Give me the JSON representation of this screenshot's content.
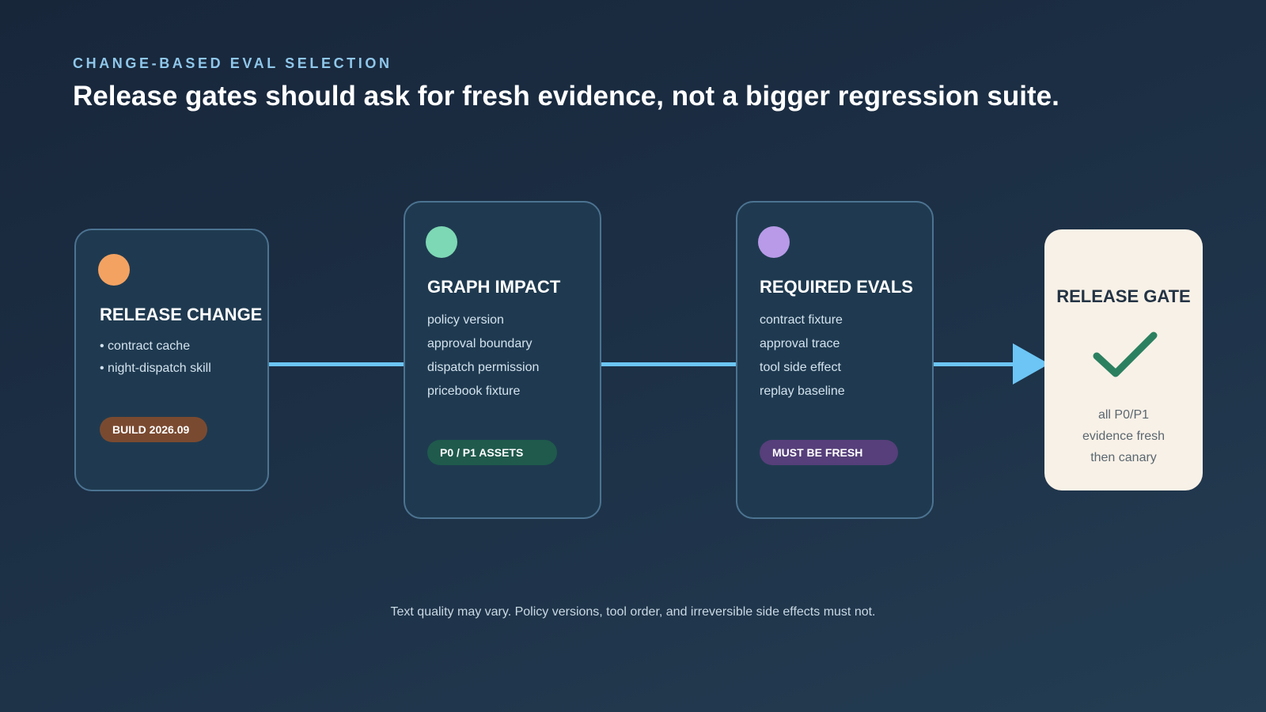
{
  "header": {
    "eyebrow": "CHANGE-BASED EVAL SELECTION",
    "headline": "Release gates should ask for fresh evidence, not a bigger regression suite."
  },
  "stages": [
    {
      "title": "RELEASE CHANGE",
      "dot_color": "#f4a261",
      "items": [
        "• contract cache",
        "• night-dispatch skill"
      ],
      "badge": "BUILD 2026.09",
      "badge_color": "#7a4a30"
    },
    {
      "title": "GRAPH IMPACT",
      "dot_color": "#7dd8b5",
      "items": [
        "policy version",
        "approval boundary",
        "dispatch permission",
        "pricebook fixture"
      ],
      "badge": "P0 / P1 ASSETS",
      "badge_color": "#1f5a4c"
    },
    {
      "title": "REQUIRED EVALS",
      "dot_color": "#b89ae8",
      "items": [
        "contract fixture",
        "approval trace",
        "tool side effect",
        "replay baseline"
      ],
      "badge": "MUST BE FRESH",
      "badge_color": "#563f7a"
    }
  ],
  "gate": {
    "title": "RELEASE GATE",
    "icon": "checkmark-icon",
    "check_color": "#2b8060",
    "lines": [
      "all P0/P1",
      "evidence fresh",
      "then canary"
    ]
  },
  "footnote": "Text quality may vary. Policy versions, tool order, and irreversible side effects must not.",
  "colors": {
    "connector": "#6cc5f5",
    "card_bg": "#1f3a50",
    "card_border": "#4c7391",
    "gate_bg": "#f8f1e7"
  }
}
